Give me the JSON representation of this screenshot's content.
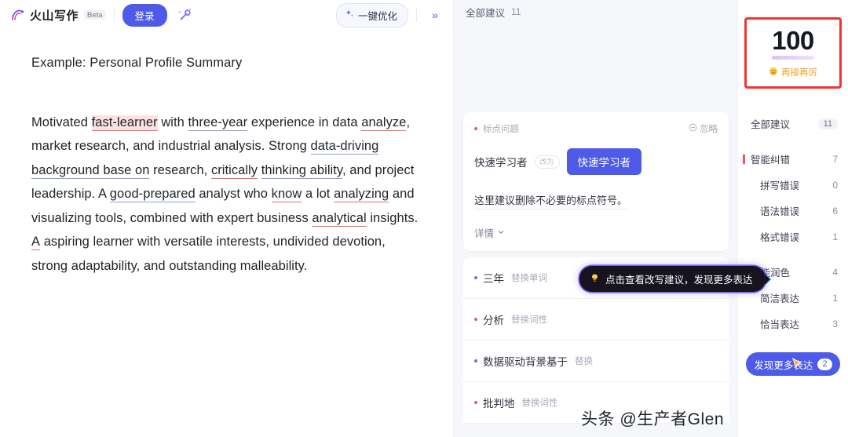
{
  "header": {
    "brand_name": "火山写作",
    "beta_label": "Beta",
    "login_label": "登录",
    "magic_icon": "magic-wand-icon",
    "optimize_label": "一键优化",
    "optimize_icon": "sparkle-icon",
    "collapse_icon": "double-chevron-right-icon",
    "collapse_label": "»"
  },
  "document": {
    "title": "Example: Personal Profile Summary",
    "paragraph_runs": [
      {
        "text": "Motivated ",
        "style": "plain"
      },
      {
        "text": "fast-learner",
        "style": "error-highlight"
      },
      {
        "text": " with ",
        "style": "plain"
      },
      {
        "text": "three-year",
        "style": "style-suggestion"
      },
      {
        "text": " experience in data ",
        "style": "plain"
      },
      {
        "text": "analyze",
        "style": "error"
      },
      {
        "text": ", market research, and industrial analysis. Strong ",
        "style": "plain"
      },
      {
        "text": "data-driving background base on",
        "style": "style-suggestion"
      },
      {
        "text": " research, ",
        "style": "plain"
      },
      {
        "text": "critically",
        "style": "error"
      },
      {
        "text": " ",
        "style": "plain"
      },
      {
        "text": "thinking ability",
        "style": "style-suggestion"
      },
      {
        "text": ", and project leadership. A ",
        "style": "plain"
      },
      {
        "text": "good-prepared",
        "style": "style-suggestion"
      },
      {
        "text": " analyst who ",
        "style": "plain"
      },
      {
        "text": "know",
        "style": "error"
      },
      {
        "text": " a lot ",
        "style": "plain"
      },
      {
        "text": "analyzing",
        "style": "error"
      },
      {
        "text": " and visualizing tools, combined with expert business ",
        "style": "plain"
      },
      {
        "text": "analytical",
        "style": "error"
      },
      {
        "text": " insights. ",
        "style": "plain"
      },
      {
        "text": "A",
        "style": "error"
      },
      {
        "text": " aspiring learner with versatile interests, undivided devotion, strong adaptability, and outstanding malleability.",
        "style": "plain"
      }
    ]
  },
  "suggestions": {
    "header_label": "全部建议",
    "header_count": "11",
    "expanded_card": {
      "tag": "标点问题",
      "ignore_label": "忽略",
      "ignore_icon": "circle-minus-icon",
      "original_text": "快速学习者",
      "arrow_chip": "改为",
      "suggestion_text": "快速学习者",
      "description": "这里建议删除不必要的标点符号。",
      "detail_label": "详情",
      "detail_icon": "chevron-down-icon"
    },
    "rows": [
      {
        "label": "三年",
        "tag": "替换单词",
        "dot": "blue"
      },
      {
        "label": "分析",
        "tag": "替换词性",
        "dot": "red"
      },
      {
        "label": "数据驱动背景基于",
        "tag": "替换",
        "dot": "blue"
      },
      {
        "label": "批判地",
        "tag": "替换词性",
        "dot": "red"
      }
    ],
    "tooltip": {
      "icon": "lightbulb-icon",
      "text": "点击查看改写建议，发现更多表达"
    }
  },
  "rail": {
    "score": "100",
    "score_sub_icon": "smiley-icon",
    "score_sub_label": "再接再厉",
    "all_suggestions": {
      "label": "全部建议",
      "count": "11"
    },
    "groups": [
      {
        "label": "智能纠错",
        "count": "7",
        "bar": "red",
        "children": [
          {
            "label": "拼写错误",
            "count": "0"
          },
          {
            "label": "语法错误",
            "count": "6"
          },
          {
            "label": "格式错误",
            "count": "1"
          }
        ]
      },
      {
        "label": "智能润色",
        "count": "4",
        "bar": "blue",
        "children": [
          {
            "label": "简洁表达",
            "count": "1"
          },
          {
            "label": "恰当表达",
            "count": "3"
          }
        ]
      }
    ],
    "discover": {
      "label": "发现更多表达",
      "badge": "2",
      "cursor_icon": "mouse-pointer-icon"
    }
  },
  "watermark": "头条 @生产者Glen",
  "colors": {
    "accent": "#4e5ae8",
    "error": "#f06a6a",
    "style": "#8e9ad6",
    "highlight_box": "#f8312f"
  }
}
